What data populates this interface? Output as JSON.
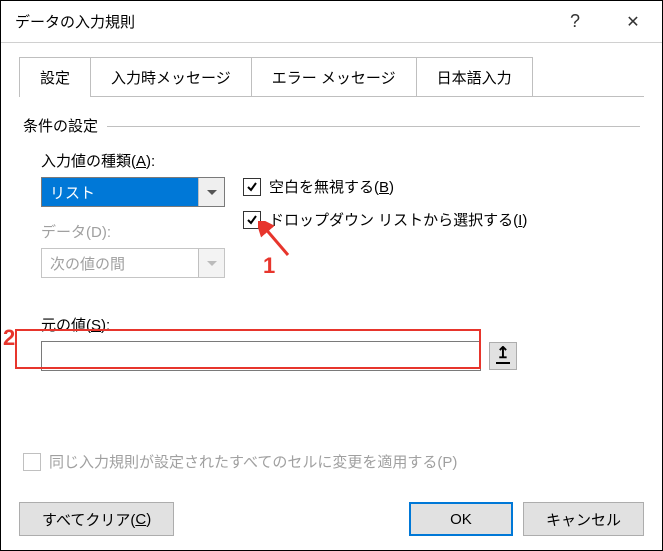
{
  "window": {
    "title": "データの入力規則"
  },
  "tabs": [
    {
      "label": "設定",
      "active": true
    },
    {
      "label": "入力時メッセージ",
      "active": false
    },
    {
      "label": "エラー メッセージ",
      "active": false
    },
    {
      "label": "日本語入力",
      "active": false
    }
  ],
  "settings": {
    "section_label": "条件の設定",
    "allow_label_pre": "入力値の種類(",
    "allow_key": "A",
    "allow_label_post": "):",
    "allow_value": "リスト",
    "data_label": "データ(D):",
    "data_value": "次の値の間",
    "ignore_blank_pre": "空白を無視する(",
    "ignore_blank_key": "B",
    "ignore_blank_post": ")",
    "ignore_blank_checked": true,
    "in_cell_pre": "ドロップダウン リストから選択する(",
    "in_cell_key": "I",
    "in_cell_post": ")",
    "in_cell_checked": true,
    "source_label_pre": "元の値(",
    "source_key": "S",
    "source_label_post": "):",
    "source_value": "",
    "apply_all_label": "同じ入力規則が設定されたすべてのセルに変更を適用する(P)"
  },
  "annotations": {
    "marker1": "1",
    "marker2": "2"
  },
  "footer": {
    "clear_pre": "すべてクリア(",
    "clear_key": "C",
    "clear_post": ")",
    "ok": "OK",
    "cancel": "キャンセル"
  }
}
